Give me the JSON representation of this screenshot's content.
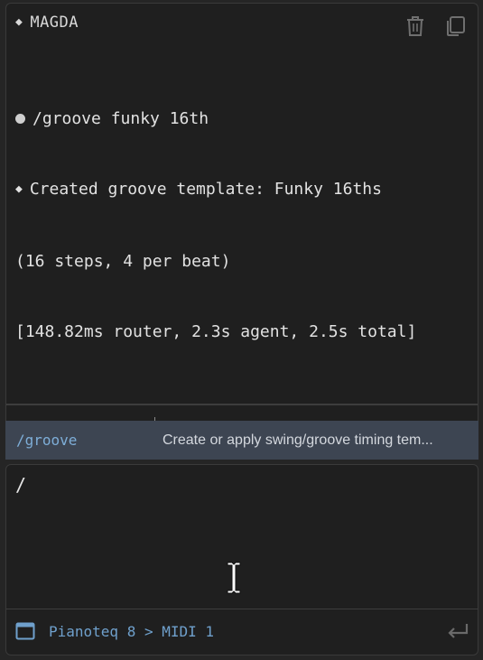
{
  "header": {
    "title": "MAGDA",
    "icons": [
      "trash-icon",
      "copy-icon"
    ]
  },
  "transcript": {
    "user_command": "/groove funky 16th",
    "response_line1": "Created groove template: Funky 16ths",
    "response_line2": "(16 steps, 4 per beat)",
    "timing": "[148.82ms router, 2.3s agent, 2.5s total]"
  },
  "suggestion": {
    "command": "/groove",
    "description": "Create or apply swing/groove timing tem..."
  },
  "input": {
    "value": "/"
  },
  "footer": {
    "device_label": "Pianoteq 8 > MIDI 1",
    "icons": [
      "window-icon",
      "enter-icon"
    ]
  },
  "colors": {
    "background": "#1f1f1f",
    "accent": "#6fa0cc",
    "suggestion_bg": "#3d4552"
  }
}
